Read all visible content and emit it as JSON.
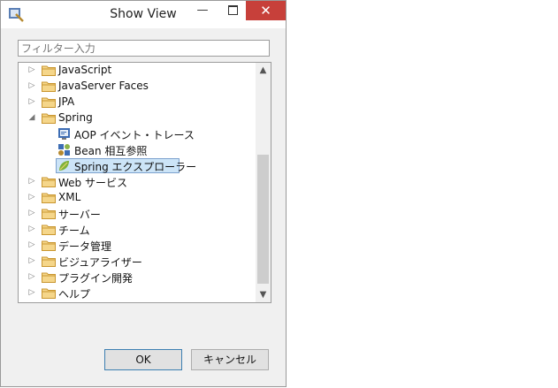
{
  "window": {
    "title": "Show View",
    "minimize_glyph": "—",
    "close_glyph": "✕"
  },
  "filter": {
    "placeholder": "フィルター入力",
    "value": ""
  },
  "tree": {
    "items": [
      {
        "label": "JavaScript",
        "expanded": false,
        "icon": "folder-icon"
      },
      {
        "label": "JavaServer Faces",
        "expanded": false,
        "icon": "folder-icon"
      },
      {
        "label": "JPA",
        "expanded": false,
        "icon": "folder-icon"
      },
      {
        "label": "Spring",
        "expanded": true,
        "icon": "folder-icon"
      },
      {
        "label": "AOP イベント・トレース",
        "child": true,
        "icon": "aop-event-trace-icon"
      },
      {
        "label": "Bean 相互参照",
        "child": true,
        "icon": "bean-cross-reference-icon"
      },
      {
        "label": "Spring エクスプローラー",
        "child": true,
        "selected": true,
        "icon": "spring-explorer-icon"
      },
      {
        "label": "Web サービス",
        "expanded": false,
        "icon": "folder-icon"
      },
      {
        "label": "XML",
        "expanded": false,
        "icon": "folder-icon"
      },
      {
        "label": "サーバー",
        "expanded": false,
        "icon": "folder-icon"
      },
      {
        "label": "チーム",
        "expanded": false,
        "icon": "folder-icon"
      },
      {
        "label": "データ管理",
        "expanded": false,
        "icon": "folder-icon"
      },
      {
        "label": "ビジュアライザー",
        "expanded": false,
        "icon": "folder-icon"
      },
      {
        "label": "プラグイン開発",
        "expanded": false,
        "icon": "folder-icon"
      },
      {
        "label": "ヘルプ",
        "expanded": false,
        "icon": "folder-icon"
      }
    ]
  },
  "buttons": {
    "ok": "OK",
    "cancel": "キャンセル"
  },
  "colors": {
    "close": "#c7403a",
    "selection": "#cce4f7",
    "folder": "#e8b94a"
  }
}
